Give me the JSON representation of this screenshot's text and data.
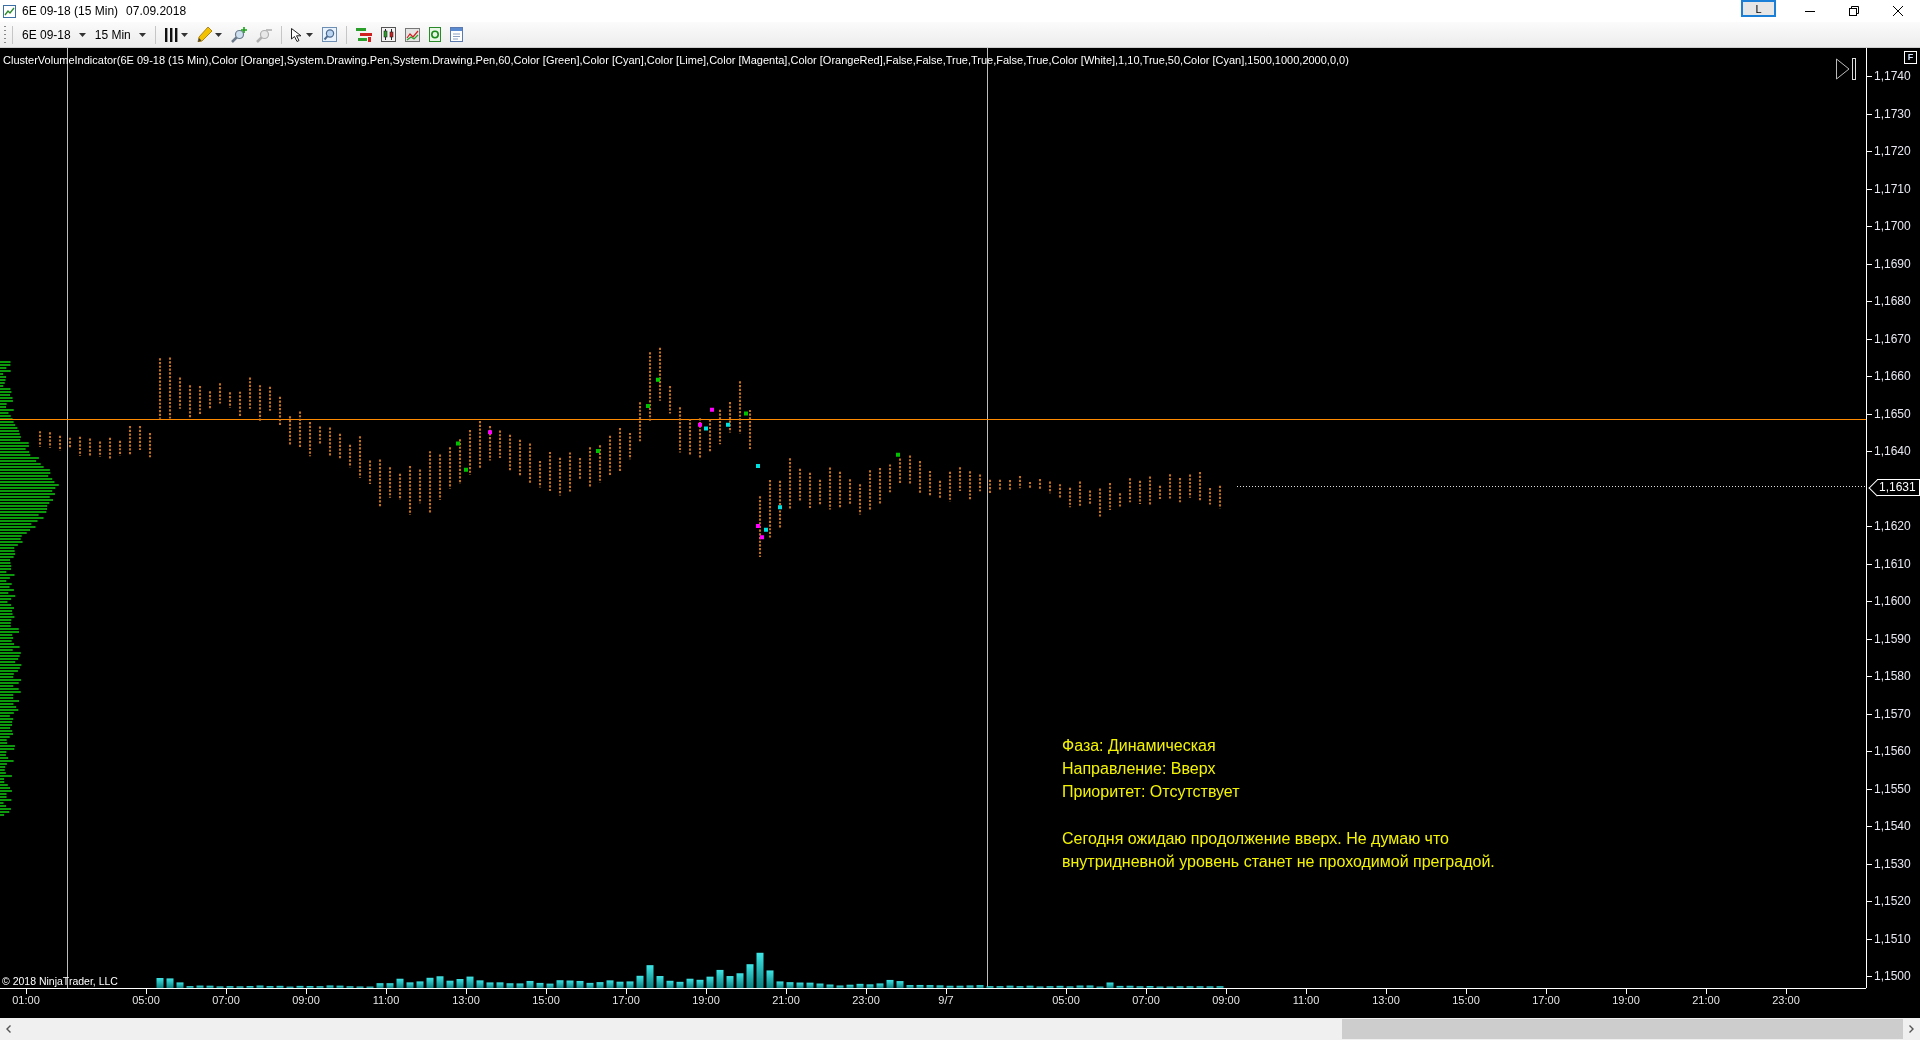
{
  "window": {
    "title": "6E 09-18 (15 Min)",
    "date": "07.09.2018",
    "layout_button": "L"
  },
  "toolbar": {
    "instrument": "6E 09-18",
    "interval": "15 Min"
  },
  "chart": {
    "indicator_label": "ClusterVolumeIndicator(6E 09-18 (15 Min),Color [Orange],System.Drawing.Pen,System.Drawing.Pen,60,Color [Green],Color [Cyan],Color [Lime],Color [Magenta],Color [OrangeRed],False,False,True,True,False,True,Color [White],1,10,True,50,Color [Cyan],1500,1000,2000,0,0)",
    "annotation": {
      "lines": [
        "Фаза: Динамическая",
        "Направление: Вверх",
        "Приоритет: Отсутствует"
      ],
      "note_lines": [
        "Сегодня ожидаю продолжение вверх. Не думаю что",
        "внутридневной уровень станет не проходимой преградой."
      ]
    },
    "copyright": "© 2018 NinjaTrader, LLC",
    "price_axis": {
      "scale_button": "F",
      "labels": [
        "1,1740",
        "1,1730",
        "1,1720",
        "1,1710",
        "1,1700",
        "1,1690",
        "1,1680",
        "1,1670",
        "1,1660",
        "1,1650",
        "1,1640",
        "1,1620",
        "1,1610",
        "1,1600",
        "1,1590",
        "1,1580",
        "1,1570",
        "1,1560",
        "1,1550",
        "1,1540",
        "1,1530",
        "1,1520",
        "1,1510",
        "1,1500"
      ],
      "current_price": "1,1631"
    },
    "time_axis": {
      "labels": [
        "01:00",
        "05:00",
        "07:00",
        "09:00",
        "11:00",
        "13:00",
        "15:00",
        "17:00",
        "19:00",
        "21:00",
        "23:00",
        "9/7",
        "05:00",
        "07:00",
        "09:00",
        "11:00",
        "13:00",
        "15:00",
        "17:00",
        "19:00",
        "21:00",
        "23:00"
      ]
    }
  }
}
